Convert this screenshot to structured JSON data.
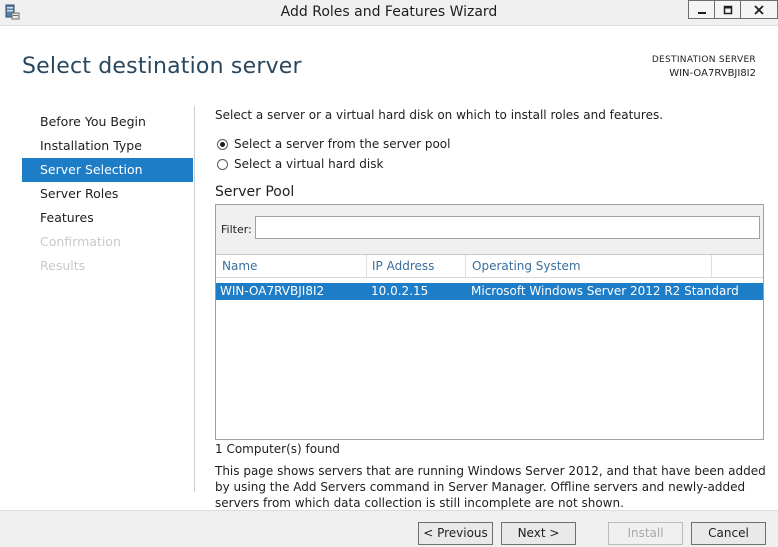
{
  "window": {
    "title": "Add Roles and Features Wizard"
  },
  "header": {
    "heading": "Select destination server",
    "destination_label": "DESTINATION SERVER",
    "destination_name": "WIN-OA7RVBJI8I2"
  },
  "nav": {
    "items": [
      {
        "label": "Before You Begin",
        "state": "normal"
      },
      {
        "label": "Installation Type",
        "state": "normal"
      },
      {
        "label": "Server Selection",
        "state": "active"
      },
      {
        "label": "Server Roles",
        "state": "normal"
      },
      {
        "label": "Features",
        "state": "normal"
      },
      {
        "label": "Confirmation",
        "state": "disabled"
      },
      {
        "label": "Results",
        "state": "disabled"
      }
    ]
  },
  "main": {
    "description": "Select a server or a virtual hard disk on which to install roles and features.",
    "options": [
      {
        "label": "Select a server from the server pool",
        "checked": true
      },
      {
        "label": "Select a virtual hard disk",
        "checked": false
      }
    ],
    "pool_heading": "Server Pool",
    "filter_label": "Filter:",
    "filter_value": "",
    "columns": [
      "Name",
      "IP Address",
      "Operating System"
    ],
    "rows": [
      {
        "name": "WIN-OA7RVBJI8I2",
        "ip": "10.0.2.15",
        "os": "Microsoft Windows Server 2012 R2 Standard",
        "selected": true
      }
    ],
    "found_text": "1 Computer(s) found",
    "note": "This page shows servers that are running Windows Server 2012, and that have been added by using the Add Servers command in Server Manager. Offline servers and newly-added servers from which data collection is still incomplete are not shown."
  },
  "footer": {
    "previous_label": "< Previous",
    "next_label": "Next >",
    "install_label": "Install",
    "cancel_label": "Cancel"
  },
  "colors": {
    "accent": "#1e7dc7",
    "heading": "#29475e",
    "column_header": "#3a6e9e",
    "disabled_text": "#c9c9c9"
  }
}
